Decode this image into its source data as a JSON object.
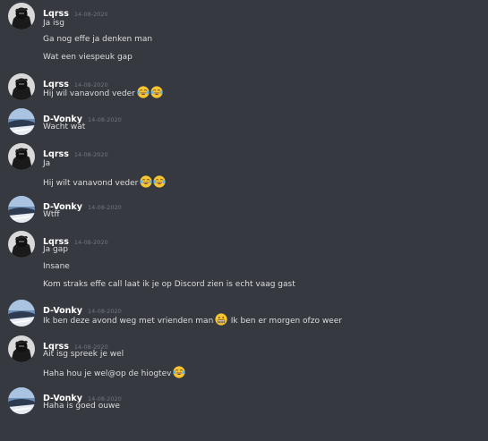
{
  "messages": [
    {
      "author": "Lqrss",
      "avatar": "lqrss-avatar",
      "timestamp": "14-08-2020",
      "lines": [
        {
          "text": "Ja isg"
        },
        {
          "text": "Ga nog effe ja denken man"
        },
        {
          "text": "Wat een viespeuk gap"
        }
      ]
    },
    {
      "author": "Lqrss",
      "avatar": "lqrss-avatar",
      "timestamp": "14-08-2020",
      "lines": [
        {
          "text": "Hij wil vanavond veder",
          "emoji": [
            "laughing-tears-icon",
            "laughing-tears-icon"
          ]
        }
      ]
    },
    {
      "author": "D-Vonky",
      "avatar": "dvonky-avatar",
      "timestamp": "14-08-2020",
      "lines": [
        {
          "text": "Wacht wat"
        }
      ]
    },
    {
      "author": "Lqrss",
      "avatar": "lqrss-avatar",
      "timestamp": "14-08-2020",
      "lines": [
        {
          "text": "Ja"
        },
        {
          "text": "Hij wilt vanavond veder",
          "emoji": [
            "laughing-tears-icon",
            "laughing-tears-icon"
          ]
        }
      ]
    },
    {
      "author": "D-Vonky",
      "avatar": "dvonky-avatar",
      "timestamp": "14-08-2020",
      "lines": [
        {
          "text": "Wtff"
        }
      ]
    },
    {
      "author": "Lqrss",
      "avatar": "lqrss-avatar",
      "timestamp": "14-08-2020",
      "lines": [
        {
          "text": "Ja gap"
        },
        {
          "text": "Insane"
        },
        {
          "text": "Kom straks effe call laat ik je op Discord zien is echt vaag gast"
        }
      ]
    },
    {
      "author": "D-Vonky",
      "avatar": "dvonky-avatar",
      "timestamp": "14-08-2020",
      "lines": [
        {
          "text": "Ik ben deze avond weg met vrienden man",
          "emoji": [
            "grimacing-face-icon"
          ],
          "after": "Ik ben er morgen ofzo weer"
        }
      ]
    },
    {
      "author": "Lqrss",
      "avatar": "lqrss-avatar",
      "timestamp": "14-08-2020",
      "lines": [
        {
          "text": "Ait isg spreek je wel"
        },
        {
          "text": "Haha hou je wel@op de hiogtev",
          "emoji": [
            "laughing-tears-icon"
          ]
        }
      ]
    },
    {
      "author": "D-Vonky",
      "avatar": "dvonky-avatar",
      "timestamp": "14-08-2020",
      "lines": [
        {
          "text": "Haha is goed ouwe"
        }
      ]
    }
  ],
  "colors": {
    "background": "#36393f",
    "username": "#ffffff",
    "timestamp": "#72767d",
    "message_text": "#dcddde"
  }
}
